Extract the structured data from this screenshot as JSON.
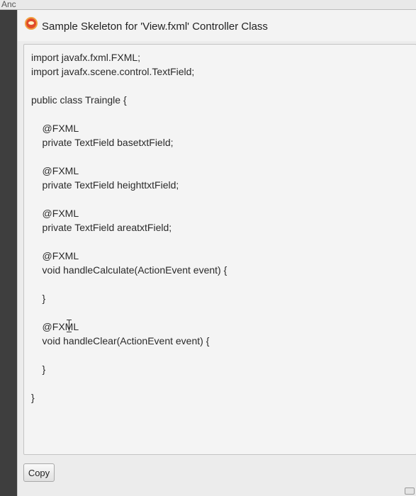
{
  "background_window": {
    "title": "Anc"
  },
  "dialog": {
    "title": "Sample Skeleton for 'View.fxml' Controller Class",
    "icon": "app-icon",
    "code_lines": [
      "import javafx.fxml.FXML;",
      "import javafx.scene.control.TextField;",
      "",
      "public class Traingle {",
      "",
      "    @FXML",
      "    private TextField basetxtField;",
      "",
      "    @FXML",
      "    private TextField heighttxtField;",
      "",
      "    @FXML",
      "    private TextField areatxtField;",
      "",
      "    @FXML",
      "    void handleCalculate(ActionEvent event) {",
      "",
      "    }",
      "",
      "    @FXML",
      "    void handleClear(ActionEvent event) {",
      "",
      "    }",
      "",
      "}"
    ],
    "copy_label": "Copy"
  }
}
